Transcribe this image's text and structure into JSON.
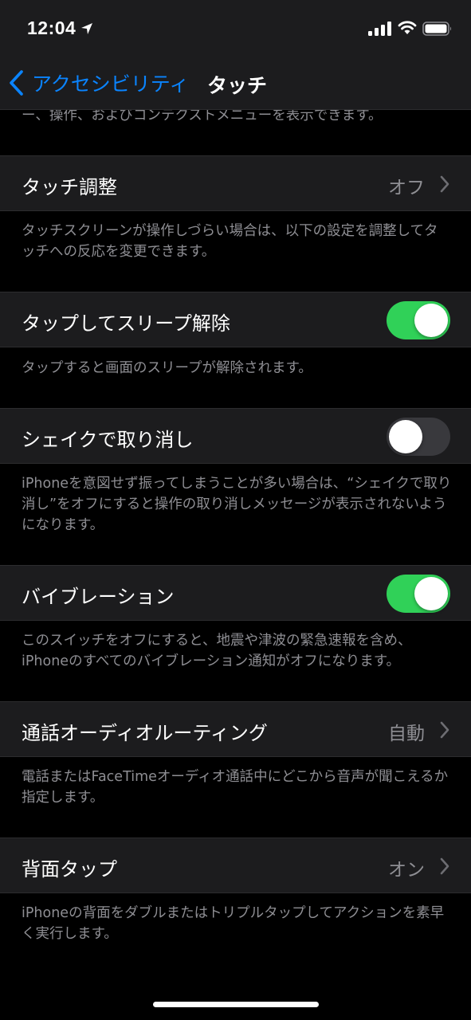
{
  "status_bar": {
    "time": "12:04"
  },
  "nav": {
    "back_label": "アクセシビリティ",
    "title": "タッチ"
  },
  "top_footer_cut": "ー、操作、およびコンテクストメニューを表示できます。",
  "rows": [
    {
      "label": "タッチ調整",
      "type": "disclosure",
      "value": "オフ",
      "footer": "タッチスクリーンが操作しづらい場合は、以下の設定を調整してタッチへの反応を変更できます。"
    },
    {
      "label": "タップしてスリープ解除",
      "type": "toggle",
      "on": true,
      "footer": "タップすると画面のスリープが解除されます。"
    },
    {
      "label": "シェイクで取り消し",
      "type": "toggle",
      "on": false,
      "footer": "iPhoneを意図せず振ってしまうことが多い場合は、“シェイクで取り消し”をオフにすると操作の取り消しメッセージが表示されないようになります。"
    },
    {
      "label": "バイブレーション",
      "type": "toggle",
      "on": true,
      "footer": "このスイッチをオフにすると、地震や津波の緊急速報を含め、iPhoneのすべてのバイブレーション通知がオフになります。"
    },
    {
      "label": "通話オーディオルーティング",
      "type": "disclosure",
      "value": "自動",
      "footer": "電話またはFaceTimeオーディオ通話中にどこから音声が聞こえるか指定します。"
    },
    {
      "label": "背面タップ",
      "type": "disclosure",
      "value": "オン",
      "footer": "iPhoneの背面をダブルまたはトリプルタップしてアクションを素早く実行します。"
    }
  ],
  "icons": {
    "back": "chevron-left-icon",
    "disclosure": "chevron-right-icon",
    "location": "location-arrow-icon",
    "signal": "cellular-signal-icon",
    "wifi": "wifi-icon",
    "battery": "battery-icon"
  },
  "colors": {
    "background": "#000000",
    "cell": "#1c1c1e",
    "accent": "#0a84ff",
    "toggle_on": "#30d158",
    "toggle_off": "#39393d",
    "secondary_text": "#8e8e93"
  }
}
